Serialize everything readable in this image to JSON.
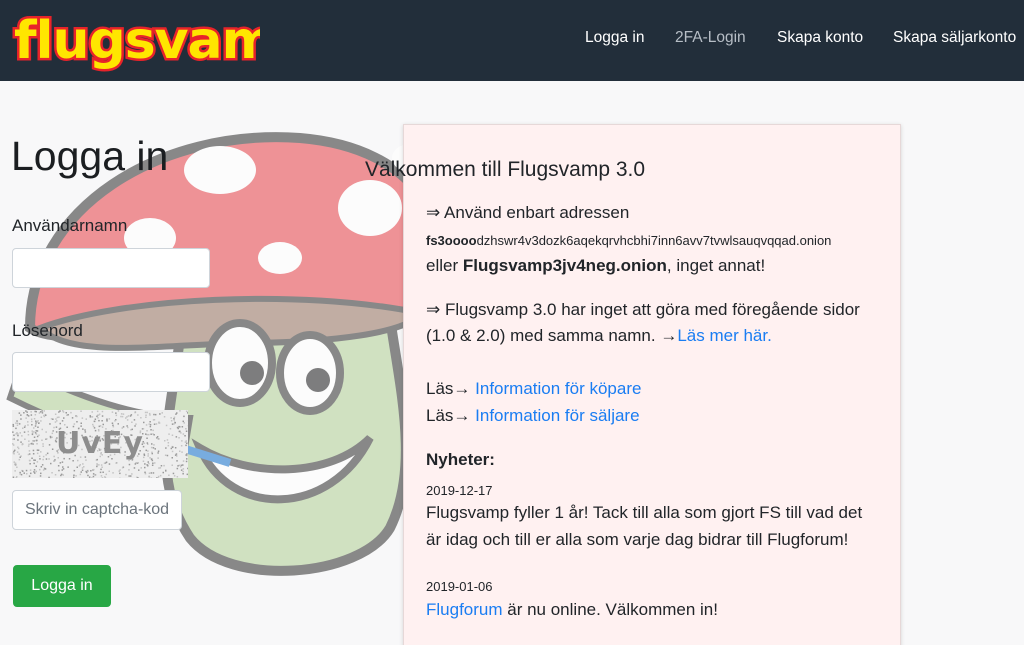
{
  "navbar": {
    "logo_text": "flugsvamp",
    "links": [
      {
        "label": "Logga in"
      },
      {
        "label": "2FA-Login"
      },
      {
        "label": "Skapa konto"
      },
      {
        "label": "Skapa säljarkonto"
      }
    ]
  },
  "login": {
    "title": "Logga in",
    "username_label": "Användarnamn",
    "username_value": "",
    "password_label": "Lösenord",
    "password_value": "",
    "captcha_text": "UvEy",
    "captcha_placeholder": "Skriv in captcha-kod",
    "submit_label": "Logga in"
  },
  "welcome": {
    "title": "Välkommen till Flugsvamp 3.0",
    "arrow": "⇒",
    "line1": " Använd enbart adressen",
    "onion_prefix": "fs3oooo",
    "onion_rest": "dzhswr4v3dozk6aqekqrvhcbhi7inn6avv7tvwlsauqvqqad.onion",
    "line3_pre": "eller ",
    "line3_bold": "Flugsvamp3jv4neg.onion",
    "line3_post": ", inget annat!",
    "p2_line1": " Flugsvamp 3.0 har inget att göra med föregående sidor",
    "p2_line2": "(1.0 & 2.0) med samma namn. →",
    "read_more": "Läs mer här.",
    "las": "Läs→ ",
    "buyer_info": "Information för köpare",
    "seller_info": "Information för säljare",
    "news_heading": "Nyheter:",
    "news": [
      {
        "date": "2019-12-17",
        "text_l1": "Flugsvamp fyller 1 år! Tack till alla som gjort FS till vad det",
        "text_l2": "är idag och till er alla som varje dag bidrar till Flugforum!"
      },
      {
        "date": "2019-01-06",
        "link": "Flugforum",
        "text_rest": " är nu online. Välkommen in!"
      }
    ]
  },
  "colors": {
    "navbar": "#222e3a",
    "button": "#28a745",
    "link": "#1a7df2",
    "card": "#fff1f1"
  }
}
